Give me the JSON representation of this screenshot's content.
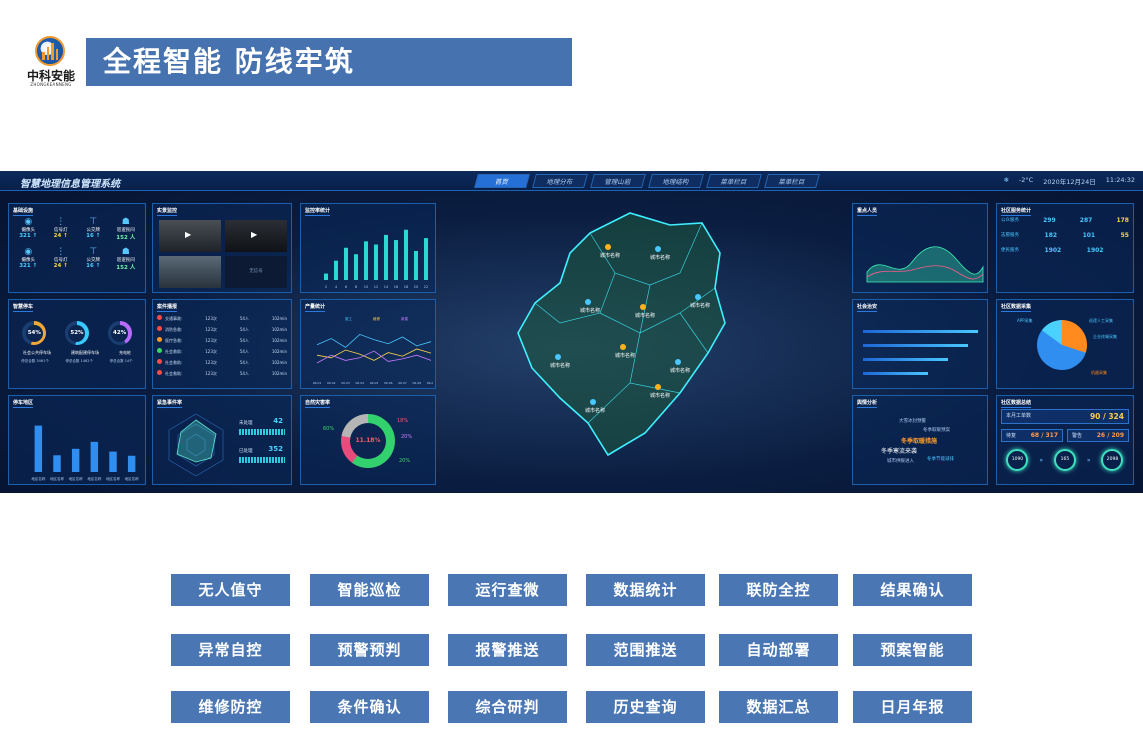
{
  "logo": {
    "name": "中科安能",
    "subtitle": "ZHONGKEANNENG"
  },
  "banner": {
    "title": "全程智能  防线牢筑"
  },
  "dashboard": {
    "app_title": "智慧地理信息管理系统",
    "nav_tabs": [
      "首页",
      "地理分布",
      "管理山岩",
      "地理结构",
      "菜单栏目",
      "菜单栏目"
    ],
    "weather": {
      "temp": "-2°C",
      "date": "2020年12月24日",
      "time": "11:24:32"
    },
    "panels": {
      "facilities": {
        "title": "基础设施",
        "items": [
          {
            "name": "摄像头",
            "count": "321 ↑"
          },
          {
            "name": "信号灯",
            "count": "24 ↑"
          },
          {
            "name": "公交牌",
            "count": "16 ↑"
          },
          {
            "name": "巡逻民间",
            "count": "152 人"
          },
          {
            "name": "摄像头",
            "count": "321 ↑"
          },
          {
            "name": "信号灯",
            "count": "24 ↑"
          },
          {
            "name": "公交牌",
            "count": "16 ↑"
          },
          {
            "name": "巡逻民间",
            "count": "152 人"
          }
        ]
      },
      "parking": {
        "title": "智慧停车",
        "rings": [
          "54%",
          "52%",
          "42%"
        ],
        "labels": [
          "社会公共停车场",
          "建筑配建停车场",
          "充电桩"
        ],
        "stats": [
          "停总合数 3461个",
          "停总合数 1462个",
          "停总合数 14个"
        ]
      },
      "parking2": {
        "title": "停车地区"
      },
      "realtime": {
        "title": "实景监控",
        "offline": "无信号"
      },
      "cases": {
        "title": "案件播报",
        "rows": [
          {
            "type": "交通事故:",
            "count": "123次",
            "people": "54人",
            "time": "102min"
          },
          {
            "type": "消防急救:",
            "count": "123次",
            "people": "54人",
            "time": "102min"
          },
          {
            "type": "医疗急救:",
            "count": "123次",
            "people": "54人",
            "time": "102min"
          },
          {
            "type": "社会救助:",
            "count": "123次",
            "people": "54人",
            "time": "102min"
          },
          {
            "type": "社会救助:",
            "count": "123次",
            "people": "54人",
            "time": "102min"
          },
          {
            "type": "社会救助:",
            "count": "123次",
            "people": "54人",
            "time": "102min"
          }
        ]
      },
      "emergency": {
        "title": "紧急事件率",
        "pending_label": "未处理",
        "pending": "42",
        "done_label": "已处理",
        "done": "352"
      },
      "monitor_stats": {
        "title": "监控率统计"
      },
      "output_stats": {
        "title": "产量统计"
      },
      "disaster": {
        "title": "自然灾害率",
        "center_pct": "11.18%",
        "pcts": [
          "60%",
          "18%",
          "20%",
          "20%"
        ]
      },
      "key_people": {
        "title": "重点人员"
      },
      "social": {
        "title": "社会治安"
      },
      "heat": {
        "title": "舆情分析",
        "tags": [
          "冬季取暖措施",
          "冬季寒流来袭",
          "大雪冰封预警",
          "冬季取暖预案",
          "城市供暖进入",
          "冬季节能减排"
        ]
      },
      "community": {
        "title": "社区服务统计",
        "items": [
          {
            "name": "公众服务",
            "a": "299",
            "b": "287",
            "c": "178"
          },
          {
            "name": "志愿服务",
            "a": "182",
            "b": "101",
            "c": "55"
          },
          {
            "name": "便民服务",
            "a": "1902",
            "b": "1902",
            "c": ""
          }
        ]
      },
      "pie": {
        "title": "社区数据采集",
        "labels": [
          "APP采集",
          "巡逻人工采集",
          "企业终端采集",
          "机器采集"
        ]
      },
      "summary": {
        "title": "社区数据总结",
        "month_label": "本月工单数",
        "month": "90 / 324",
        "a_label": "待复",
        "a": "68 / 317",
        "b_label": "警告",
        "b": "26 / 209",
        "circles": [
          "1090",
          "165",
          "2098"
        ]
      }
    },
    "map_cities": [
      "城市名称",
      "城市名称",
      "城市名称",
      "城市名称",
      "城市名称",
      "城市名称",
      "城市名称",
      "城市名称",
      "城市名称",
      "城市名称"
    ]
  },
  "chart_data": [
    {
      "type": "bar",
      "title": "监控率统计",
      "categories": [
        "2",
        "4",
        "6",
        "8",
        "10",
        "12",
        "14",
        "16",
        "18",
        "20",
        "22"
      ],
      "values": [
        10,
        30,
        50,
        40,
        60,
        55,
        70,
        62,
        78,
        45,
        65
      ],
      "ylim": [
        0,
        90
      ]
    },
    {
      "type": "bar",
      "title": "停车地区",
      "categories": [
        "地区名称",
        "地区名称",
        "地区名称",
        "地区名称",
        "地区名称",
        "地区名称"
      ],
      "values": [
        10000,
        3600,
        5000,
        6500,
        4400,
        3500
      ],
      "ylim": [
        0,
        12500
      ]
    },
    {
      "type": "line",
      "title": "产量统计",
      "x": [
        "06.01",
        "06.02",
        "06.03",
        "06.04",
        "06.05",
        "06.06",
        "06.07",
        "06.08",
        "06.09"
      ],
      "series": [
        {
          "name": "施工",
          "values": [
            60,
            72,
            55,
            80,
            70,
            62,
            75,
            58,
            66
          ]
        },
        {
          "name": "维修",
          "values": [
            40,
            35,
            50,
            42,
            30,
            45,
            38,
            52,
            44
          ]
        },
        {
          "name": "新建",
          "values": [
            25,
            40,
            30,
            35,
            48,
            28,
            33,
            40,
            30
          ]
        }
      ],
      "ylim": [
        0,
        100
      ]
    }
  ],
  "buttons": [
    [
      "无人值守",
      "智能巡检",
      "运行查微",
      "数据统计",
      "联防全控",
      "结果确认"
    ],
    [
      "异常自控",
      "预警预判",
      "报警推送",
      "范围推送",
      "自动部署",
      "预案智能"
    ],
    [
      "维修防控",
      "条件确认",
      "综合研判",
      "历史查询",
      "数据汇总",
      "日月年报"
    ]
  ]
}
